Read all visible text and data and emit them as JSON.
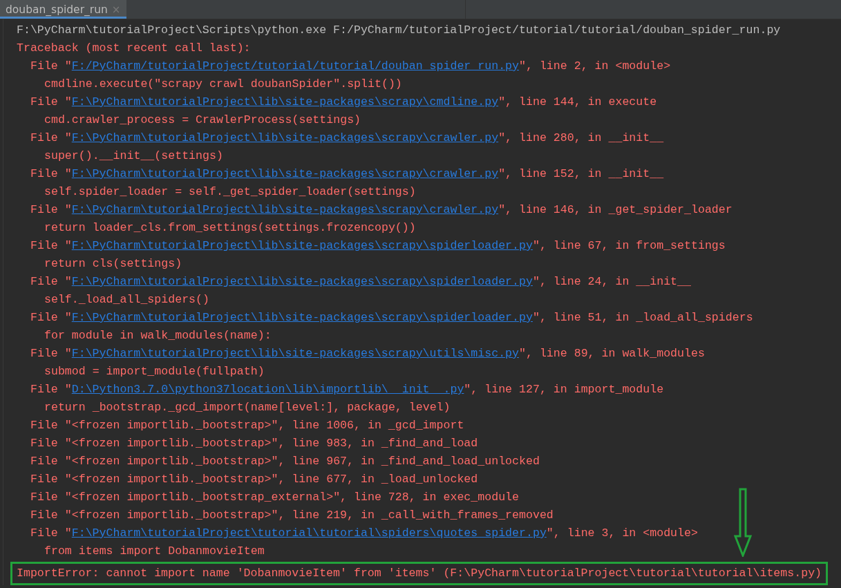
{
  "tab": {
    "title": "douban_spider_run",
    "close": "×",
    "selected": true
  },
  "lines": [
    {
      "kind": "command",
      "text": "F:\\PyCharm\\tutorialProject\\Scripts\\python.exe F:/PyCharm/tutorialProject/tutorial/tutorial/douban_spider_run.py"
    },
    {
      "kind": "error",
      "text": "Traceback (most recent call last):"
    },
    {
      "kind": "frame",
      "prefix": "File \"",
      "link": "F:/PyCharm/tutorialProject/tutorial/tutorial/douban_spider_run.py",
      "suffix": "\", line 2, in <module>"
    },
    {
      "kind": "code",
      "text": "cmdline.execute(\"scrapy crawl doubanSpider\".split())"
    },
    {
      "kind": "frame",
      "prefix": "File \"",
      "link": "F:\\PyCharm\\tutorialProject\\lib\\site-packages\\scrapy\\cmdline.py",
      "suffix": "\", line 144, in execute"
    },
    {
      "kind": "code",
      "text": "cmd.crawler_process = CrawlerProcess(settings)"
    },
    {
      "kind": "frame",
      "prefix": "File \"",
      "link": "F:\\PyCharm\\tutorialProject\\lib\\site-packages\\scrapy\\crawler.py",
      "suffix": "\", line 280, in __init__"
    },
    {
      "kind": "code",
      "text": "super().__init__(settings)"
    },
    {
      "kind": "frame",
      "prefix": "File \"",
      "link": "F:\\PyCharm\\tutorialProject\\lib\\site-packages\\scrapy\\crawler.py",
      "suffix": "\", line 152, in __init__"
    },
    {
      "kind": "code",
      "text": "self.spider_loader = self._get_spider_loader(settings)"
    },
    {
      "kind": "frame",
      "prefix": "File \"",
      "link": "F:\\PyCharm\\tutorialProject\\lib\\site-packages\\scrapy\\crawler.py",
      "suffix": "\", line 146, in _get_spider_loader"
    },
    {
      "kind": "code",
      "text": "return loader_cls.from_settings(settings.frozencopy())"
    },
    {
      "kind": "frame",
      "prefix": "File \"",
      "link": "F:\\PyCharm\\tutorialProject\\lib\\site-packages\\scrapy\\spiderloader.py",
      "suffix": "\", line 67, in from_settings"
    },
    {
      "kind": "code",
      "text": "return cls(settings)"
    },
    {
      "kind": "frame",
      "prefix": "File \"",
      "link": "F:\\PyCharm\\tutorialProject\\lib\\site-packages\\scrapy\\spiderloader.py",
      "suffix": "\", line 24, in __init__"
    },
    {
      "kind": "code",
      "text": "self._load_all_spiders()"
    },
    {
      "kind": "frame",
      "prefix": "File \"",
      "link": "F:\\PyCharm\\tutorialProject\\lib\\site-packages\\scrapy\\spiderloader.py",
      "suffix": "\", line 51, in _load_all_spiders"
    },
    {
      "kind": "code",
      "text": "for module in walk_modules(name):"
    },
    {
      "kind": "frame",
      "prefix": "File \"",
      "link": "F:\\PyCharm\\tutorialProject\\lib\\site-packages\\scrapy\\utils\\misc.py",
      "suffix": "\", line 89, in walk_modules"
    },
    {
      "kind": "code",
      "text": "submod = import_module(fullpath)"
    },
    {
      "kind": "frame",
      "prefix": "File \"",
      "link": "D:\\Python3.7.0\\python37location\\lib\\importlib\\__init__.py",
      "suffix": "\", line 127, in import_module"
    },
    {
      "kind": "code",
      "text": "return _bootstrap._gcd_import(name[level:], package, level)"
    },
    {
      "kind": "plainframe",
      "text": "File \"<frozen importlib._bootstrap>\", line 1006, in _gcd_import"
    },
    {
      "kind": "plainframe",
      "text": "File \"<frozen importlib._bootstrap>\", line 983, in _find_and_load"
    },
    {
      "kind": "plainframe",
      "text": "File \"<frozen importlib._bootstrap>\", line 967, in _find_and_load_unlocked"
    },
    {
      "kind": "plainframe",
      "text": "File \"<frozen importlib._bootstrap>\", line 677, in _load_unlocked"
    },
    {
      "kind": "plainframe",
      "text": "File \"<frozen importlib._bootstrap_external>\", line 728, in exec_module"
    },
    {
      "kind": "plainframe",
      "text": "File \"<frozen importlib._bootstrap>\", line 219, in _call_with_frames_removed"
    },
    {
      "kind": "frame",
      "prefix": "File \"",
      "link": "F:\\PyCharm\\tutorialProject\\tutorial\\tutorial\\spiders\\quotes_spider.py",
      "suffix": "\", line 3, in <module>"
    },
    {
      "kind": "code",
      "text": "from items import DobanmovieItem"
    },
    {
      "kind": "highlighted",
      "text": "ImportError: cannot import name 'DobanmovieItem' from 'items' (F:\\PyCharm\\tutorialProject\\tutorial\\tutorial\\items.py)"
    }
  ]
}
